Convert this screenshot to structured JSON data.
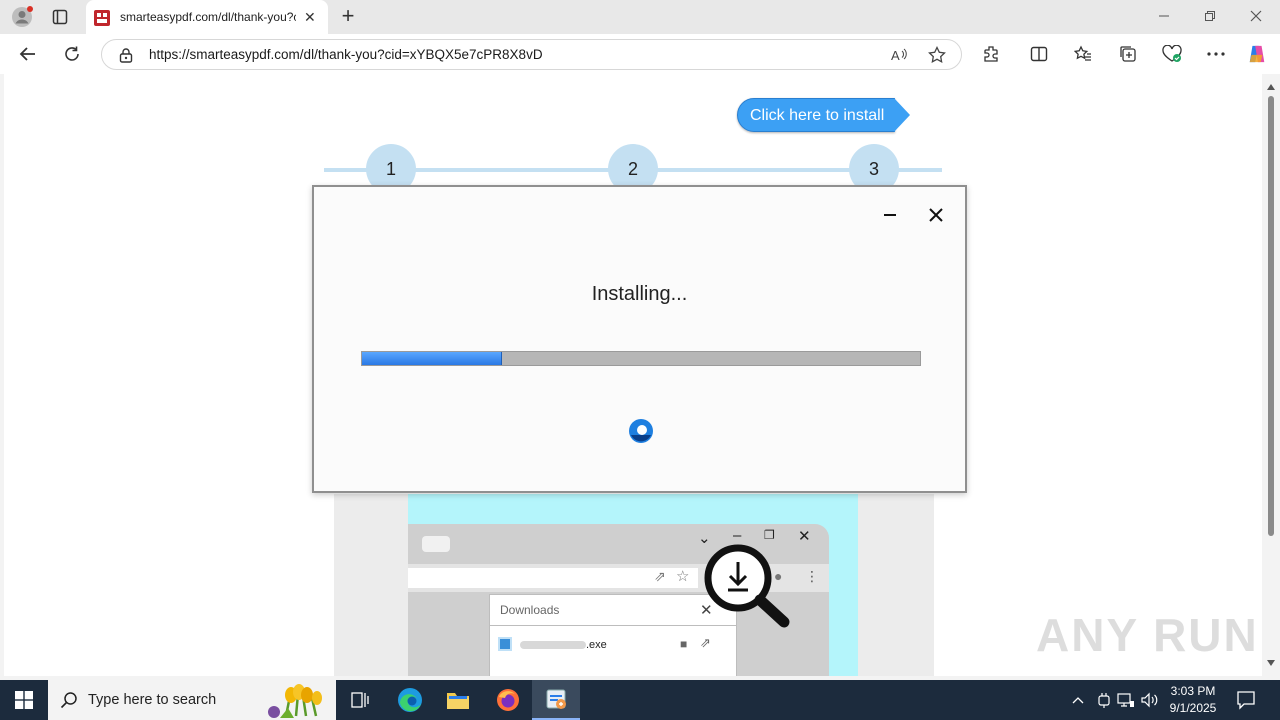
{
  "browser": {
    "tab_title": "smarteasypdf.com/dl/thank-you?cid",
    "url": "https://smarteasypdf.com/dl/thank-you?cid=xYBQX5e7cPR8X8vD"
  },
  "page": {
    "install_button": "Click here to install",
    "steps": [
      "1",
      "2",
      "3"
    ],
    "downloads_title": "Downloads",
    "download_file": ".exe",
    "watermark": "ANY RUN"
  },
  "dialog": {
    "status": "Installing...",
    "progress_percent": 25
  },
  "taskbar": {
    "search_placeholder": "Type here to search",
    "time": "3:03 PM",
    "date": "9/1/2025"
  },
  "colors": {
    "install_button": "#3ca0f4",
    "progress": "#2a78e4",
    "step_circle": "#c4e0f2",
    "taskbar": "#1c2b3d"
  }
}
